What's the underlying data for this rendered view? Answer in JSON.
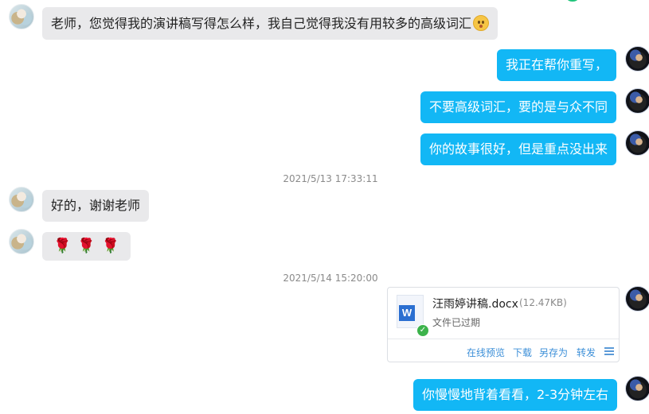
{
  "messages": {
    "m1": "老师，您觉得我的演讲稿写得怎么样，我自己觉得我没有用较多的高级词汇",
    "m2": "我正在帮你重写，",
    "m3": "不要高级词汇，要的是与众不同",
    "m4": "你的故事很好，但是重点没出来",
    "m5": "好的，谢谢老师",
    "m7": "你慢慢地背着看看，2-3分钟左右"
  },
  "timestamps": {
    "t1": "2021/5/13 17:33:11",
    "t2": "2021/5/14 15:20:00"
  },
  "rose_message": {
    "count": 3,
    "glyph": "🌹"
  },
  "file": {
    "icon_letter": "W",
    "name": "汪雨婷讲稿.docx",
    "size": "(12.47KB)",
    "status": "文件已过期",
    "actions": {
      "preview": "在线预览",
      "download": "下载",
      "save_as": "另存为",
      "forward": "转发"
    }
  },
  "colors": {
    "outgoing_bubble": "#12b7f5",
    "incoming_bubble": "#e9e9eb",
    "link": "#3c8fd8"
  }
}
